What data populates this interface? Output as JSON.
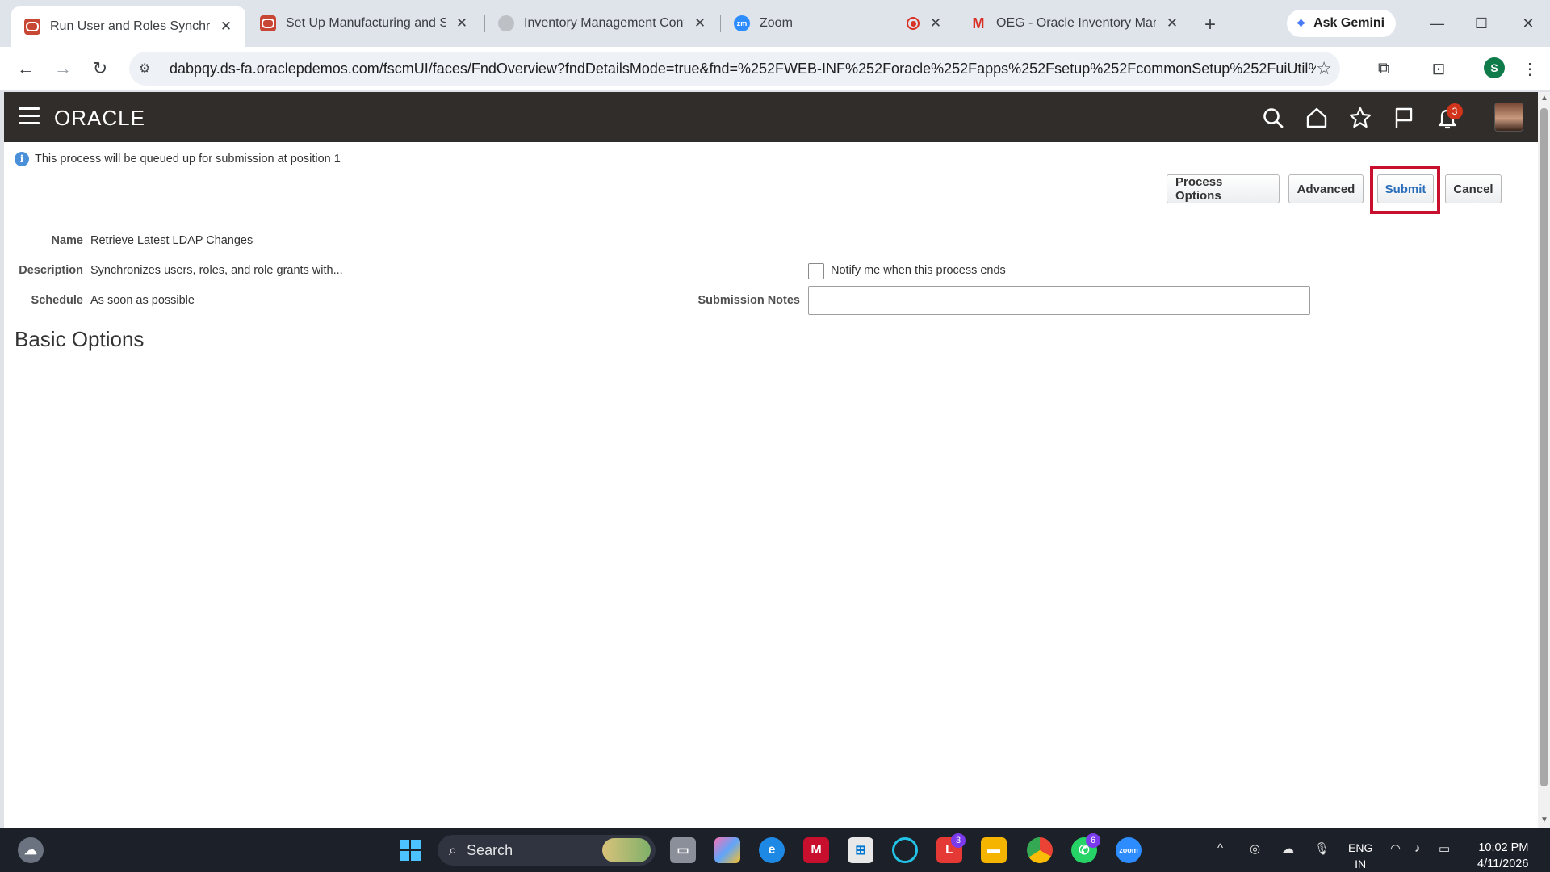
{
  "browser": {
    "tabs": [
      {
        "title": "Run User and Roles Synchroni",
        "favicon": "oracle-icon",
        "active": true
      },
      {
        "title": "Set Up Manufacturing and Sup",
        "favicon": "oracle-icon",
        "active": false
      },
      {
        "title": "Inventory Management Config",
        "favicon": "globe-icon",
        "active": false
      },
      {
        "title": "Zoom",
        "favicon": "zoom-icon",
        "active": false
      },
      {
        "title": "OEG - Oracle Inventory Manag",
        "favicon": "gmail-icon",
        "active": false
      }
    ],
    "new_tab": "+",
    "gemini_label": "Ask Gemini",
    "url": "dabpqy.ds-fa.oraclepdemos.com/fscmUI/faces/FndOverview?fndDetailsMode=true&fnd=%252FWEB-INF%252Foracle%252Fapps%252Fsetup%252FcommonSetup%252FuiUtil%252F...",
    "profile_initial": "S",
    "zoom_favicon_text": "zm"
  },
  "app": {
    "logo": "ORACLE",
    "notification_count": "3",
    "accent_color": "#312d2a"
  },
  "page": {
    "info_message": "This process will be queued up for submission at position 1",
    "buttons": {
      "process_options": "Process Options",
      "advanced": "Advanced",
      "submit": "Submit",
      "cancel": "Cancel"
    },
    "fields": {
      "name_label": "Name",
      "name_value": "Retrieve Latest LDAP Changes",
      "description_label": "Description",
      "description_value": "Synchronizes users, roles, and role grants with...",
      "schedule_label": "Schedule",
      "schedule_value": "As soon as possible",
      "notify_label": "Notify me when this process ends",
      "submission_notes_label": "Submission Notes",
      "submission_notes_value": ""
    },
    "section_title": "Basic Options"
  },
  "taskbar": {
    "search_label": "Search",
    "badges": {
      "l_app": "3",
      "whatsapp": "6"
    },
    "language": [
      "ENG",
      "IN"
    ],
    "time": "10:02 PM",
    "date": "4/11/2026"
  }
}
